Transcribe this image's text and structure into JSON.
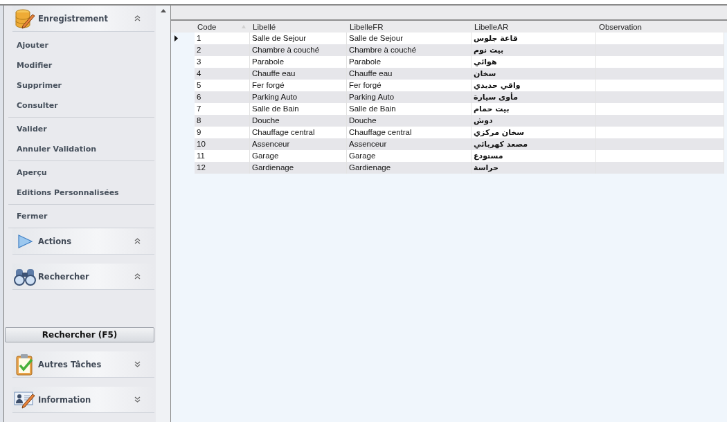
{
  "sidebar": {
    "panels": [
      {
        "kind": "database",
        "title": "Enregistrement",
        "expanded": true,
        "groups": [
          [
            "Ajouter",
            "Modifier",
            "Supprimer",
            "Consulter"
          ],
          [
            "Valider",
            "Annuler Validation"
          ],
          [
            "Aperçu",
            "Editions Personnalisées"
          ],
          [
            "Fermer"
          ]
        ]
      },
      {
        "kind": "play",
        "title": "Actions",
        "expanded": true
      },
      {
        "kind": "binoculars",
        "title": "Rechercher",
        "expanded": true,
        "button": "Rechercher (F5)"
      },
      {
        "kind": "clipboard",
        "title": "Autres Tâches",
        "expanded": false
      },
      {
        "kind": "contact",
        "title": "Information",
        "expanded": false
      }
    ]
  },
  "table": {
    "columns": [
      {
        "label": "Code",
        "sorted": true
      },
      {
        "label": "Libellé",
        "sorted": false
      },
      {
        "label": "LibelleFR",
        "sorted": false
      },
      {
        "label": "LibelleAR",
        "sorted": false
      },
      {
        "label": "Observation",
        "sorted": false
      }
    ],
    "rows": [
      {
        "current": true,
        "cells": [
          "1",
          "Salle de Sejour",
          "Salle de Sejour",
          "قاعة جلوس",
          ""
        ]
      },
      {
        "current": false,
        "cells": [
          "2",
          "Chambre à couché",
          "Chambre à couché",
          "بيت نوم",
          ""
        ]
      },
      {
        "current": false,
        "cells": [
          "3",
          "Parabole",
          "Parabole",
          "هوائي",
          ""
        ]
      },
      {
        "current": false,
        "cells": [
          "4",
          "Chauffe eau",
          "Chauffe eau",
          "سخان",
          ""
        ]
      },
      {
        "current": false,
        "cells": [
          "5",
          "Fer forgé",
          "Fer forgé",
          "واقي حديدي",
          ""
        ]
      },
      {
        "current": false,
        "cells": [
          "6",
          "Parking Auto",
          "Parking Auto",
          "مأوى سيارة",
          ""
        ]
      },
      {
        "current": false,
        "cells": [
          "7",
          "Salle de Bain",
          "Salle de Bain",
          "بيت حمام",
          ""
        ]
      },
      {
        "current": false,
        "cells": [
          "8",
          "Douche",
          "Douche",
          "دوش",
          ""
        ]
      },
      {
        "current": false,
        "cells": [
          "9",
          "Chauffage central",
          "Chauffage central",
          "سخان مركزي",
          ""
        ]
      },
      {
        "current": false,
        "cells": [
          "10",
          "Assenceur",
          "Assenceur",
          "مصعد كهربائي",
          ""
        ]
      },
      {
        "current": false,
        "cells": [
          "11",
          "Garage",
          "Garage",
          "مستودع",
          ""
        ]
      },
      {
        "current": false,
        "cells": [
          "12",
          "Gardienage",
          "Gardienage",
          "حراسة",
          ""
        ]
      }
    ]
  }
}
